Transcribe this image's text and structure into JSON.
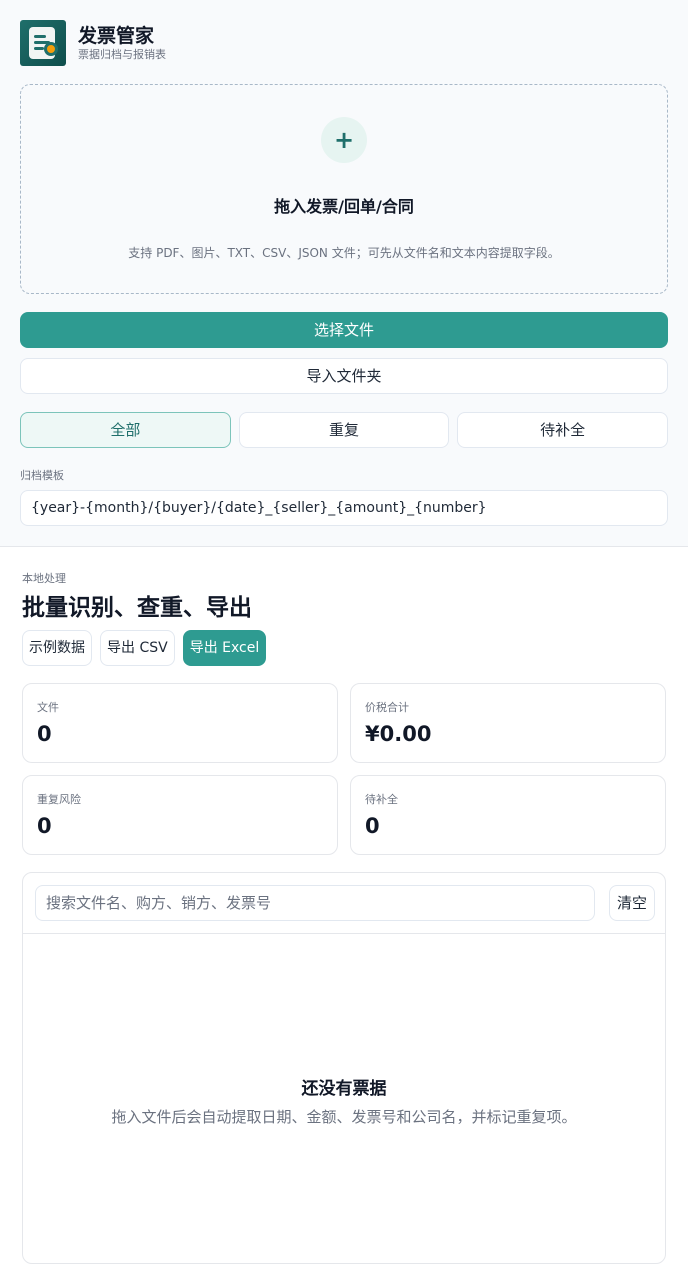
{
  "header": {
    "title": "发票管家",
    "subtitle": "票据归档与报销表"
  },
  "dropzone": {
    "icon": "plus-icon",
    "plus": "+",
    "title": "拖入发票/回单/合同",
    "hint": "支持 PDF、图片、TXT、CSV、JSON 文件；可先从文件名和文本内容提取字段。"
  },
  "buttons": {
    "choose_file": "选择文件",
    "import_folder": "导入文件夹"
  },
  "filters": [
    {
      "label": "全部",
      "active": true
    },
    {
      "label": "重复",
      "active": false
    },
    {
      "label": "待补全",
      "active": false
    }
  ],
  "template": {
    "label": "归档模板",
    "value": "{year}-{month}/{buyer}/{date}_{seller}_{amount}_{number}"
  },
  "main": {
    "eyebrow": "本地处理",
    "title": "批量识别、查重、导出",
    "actions": {
      "sample": "示例数据",
      "export_csv": "导出 CSV",
      "export_excel": "导出 Excel"
    }
  },
  "stats": {
    "files": {
      "label": "文件",
      "value": "0"
    },
    "total": {
      "label": "价税合计",
      "value": "¥0.00"
    },
    "duplicates": {
      "label": "重复风险",
      "value": "0"
    },
    "pending": {
      "label": "待补全",
      "value": "0"
    }
  },
  "list": {
    "search_placeholder": "搜索文件名、购方、销方、发票号",
    "search_value": "",
    "clear": "清空",
    "empty_title": "还没有票据",
    "empty_hint": "拖入文件后会自动提取日期、金额、发票号和公司名，并标记重复项。"
  },
  "colors": {
    "accent": "#2e9b91",
    "accent_dark": "#1f6f6b",
    "background": "#f8fafc"
  }
}
